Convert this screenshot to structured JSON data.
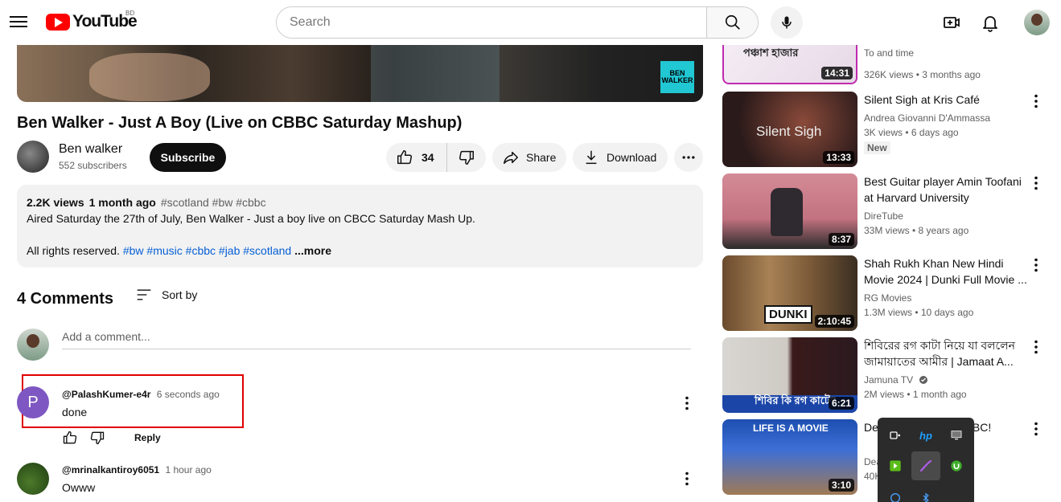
{
  "header": {
    "logo_text": "YouTube",
    "country_code": "BD",
    "search_placeholder": "Search"
  },
  "video": {
    "overlay_logo": "BEN WALKER",
    "title": "Ben Walker - Just A Boy (Live on CBBC Saturday Mashup)",
    "channel": "Ben walker",
    "subscribers": "552 subscribers",
    "subscribe_label": "Subscribe",
    "likes": "34",
    "share_label": "Share",
    "download_label": "Download"
  },
  "description": {
    "views": "2.2K views",
    "age": "1 month ago",
    "tags": "#scotland #bw #cbbc",
    "line1": "Aired Saturday the 27th of July, Ben Walker - Just a boy live on CBCC Saturday Mash Up.",
    "rights": "All rights reserved.",
    "hashtags": [
      "#bw",
      "#music",
      "#cbbc",
      "#jab",
      "#scotland"
    ],
    "more_label": "...more"
  },
  "comments": {
    "count_label": "4 Comments",
    "sort_label": "Sort by",
    "add_placeholder": "Add a comment...",
    "reply_label": "Reply",
    "items": [
      {
        "avatar_letter": "P",
        "author": "@PalashKumer-e4r",
        "time": "6 seconds ago",
        "text": "done"
      },
      {
        "avatar_letter": "",
        "author": "@mrinalkantiroy6051",
        "time": "1 hour ago",
        "text": "Owww"
      }
    ]
  },
  "recommendations": [
    {
      "thumb_text": "পঞ্চাশ হাজার",
      "duration": "14:31",
      "title": "To and time",
      "channel": "",
      "meta": "326K views • 3 months ago",
      "badge": ""
    },
    {
      "thumb_text": "Silent Sigh",
      "duration": "13:33",
      "title": "Silent Sigh at Kris Café",
      "channel": "Andrea Giovanni D'Ammassa",
      "meta": "3K views • 6 days ago",
      "badge": "New"
    },
    {
      "thumb_text": "",
      "duration": "8:37",
      "title": "Best Guitar player Amin Toofani at Harvard University",
      "channel": "DireTube",
      "meta": "33M views • 8 years ago",
      "badge": ""
    },
    {
      "thumb_text": "DUNKI",
      "duration": "2:10:45",
      "title": "Shah Rukh Khan New Hindi Movie 2024 | Dunki Full Movie ...",
      "channel": "RG Movies",
      "meta": "1.3M views • 10 days ago",
      "badge": ""
    },
    {
      "thumb_text": "শিবির কি রগ কাটে?",
      "duration": "6:21",
      "title": "শিবিরের রগ কাটা নিয়ে যা বললেন জামায়াতের আমীর | Jamaat A...",
      "channel": "Jamuna TV",
      "meta": "2M views • 1 month ago",
      "badge": ""
    },
    {
      "thumb_text": "LIFE IS A MOVIE",
      "duration": "3:10",
      "title": "De... \"Life is a Mo... BBC!",
      "channel": "Dea... age",
      "meta": "40K...",
      "badge": ""
    }
  ],
  "tray_icons": [
    "camera-icon",
    "hp-icon",
    "display-icon",
    "nvidia-icon",
    "pen-icon",
    "utorrent-icon",
    "cloud-icon",
    "bluetooth-icon"
  ],
  "colors": {
    "brand_red": "#ff0000",
    "link_blue": "#065fd4",
    "highlight_red": "#e00000"
  }
}
